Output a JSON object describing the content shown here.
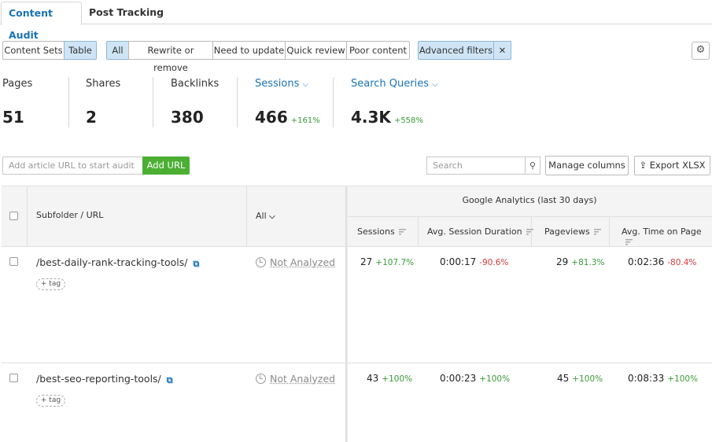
{
  "tabs": [
    {
      "label": "Content Audit"
    },
    {
      "label": "Post Tracking"
    }
  ],
  "view_toggle": {
    "content_sets": "Content Sets",
    "table": "Table"
  },
  "filters": {
    "all": "All",
    "rewrite": "Rewrite or remove",
    "update": "Need to update",
    "quick": "Quick review",
    "poor": "Poor content",
    "advanced": "Advanced filters",
    "close": "✕"
  },
  "metrics": {
    "pages": {
      "label": "Pages",
      "value": "51"
    },
    "shares": {
      "label": "Shares",
      "value": "2"
    },
    "backlinks": {
      "label": "Backlinks",
      "value": "380"
    },
    "sessions": {
      "label": "Sessions",
      "value": "466",
      "change": "+161%"
    },
    "queries": {
      "label": "Search Queries",
      "value": "4.3K",
      "change": "+558%"
    }
  },
  "url_bar": {
    "placeholder": "Add article URL to start audit",
    "button": "Add URL"
  },
  "search": {
    "placeholder": "Search"
  },
  "tools": {
    "manage": "Manage columns",
    "export": "Export XLSX"
  },
  "table": {
    "col_url": "Subfolder / URL",
    "col_status": "All",
    "group_title": "Google Analytics (last 30 days)",
    "col_sessions": "Sessions",
    "col_duration": "Avg. Session Duration",
    "col_pageviews": "Pageviews",
    "col_time": "Avg. Time on Page",
    "tag_label": "+ tag",
    "rows": [
      {
        "url": "/best-daily-rank-tracking-tools/",
        "status": "Not Analyzed",
        "sessions": "27",
        "sessions_change": "+107.7%",
        "duration": "0:00:17",
        "duration_change": "-90.6%",
        "pageviews": "29",
        "pageviews_change": "+81.3%",
        "time": "0:02:36",
        "time_change": "-80.4%"
      },
      {
        "url": "/best-seo-reporting-tools/",
        "status": "Not Analyzed",
        "sessions": "43",
        "sessions_change": "+100%",
        "duration": "0:00:23",
        "duration_change": "+100%",
        "pageviews": "45",
        "pageviews_change": "+100%",
        "time": "0:08:33",
        "time_change": "+100%"
      }
    ]
  },
  "colors": {
    "accent": "#1a73b8",
    "green": "#4caf34",
    "positive": "#3a9a3a",
    "negative": "#d63a3a"
  },
  "icons": [
    "gear-icon",
    "close-icon",
    "chevron-down-icon",
    "search-icon",
    "export-icon",
    "external-link-icon",
    "clock-icon",
    "sort-icon"
  ]
}
